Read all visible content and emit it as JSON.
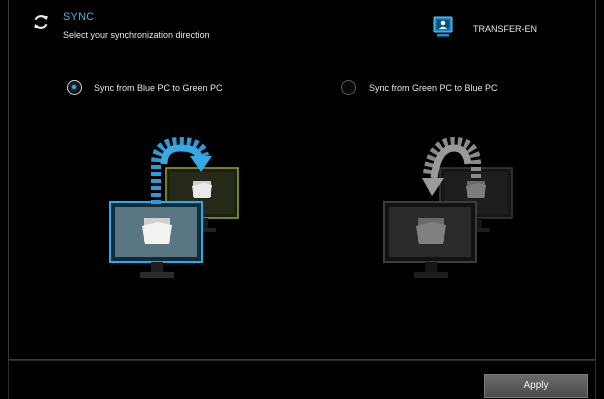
{
  "header": {
    "title": "SYNC",
    "subtitle": "Select your synchronization direction",
    "device_label": "TRANSFER-EN"
  },
  "options": [
    {
      "label": "Sync from Blue PC to Green PC",
      "selected": true
    },
    {
      "label": "Sync from Green PC to Blue PC",
      "selected": false
    }
  ],
  "footer": {
    "apply_label": "Apply"
  },
  "colors": {
    "accent_blue": "#4fb0e6",
    "green_monitor": "#8fa832",
    "arrow_gray": "#9a9a9a"
  },
  "icons": [
    "sync-icon",
    "monitor-user-icon",
    "folder-icon",
    "curved-arrow-icon"
  ]
}
